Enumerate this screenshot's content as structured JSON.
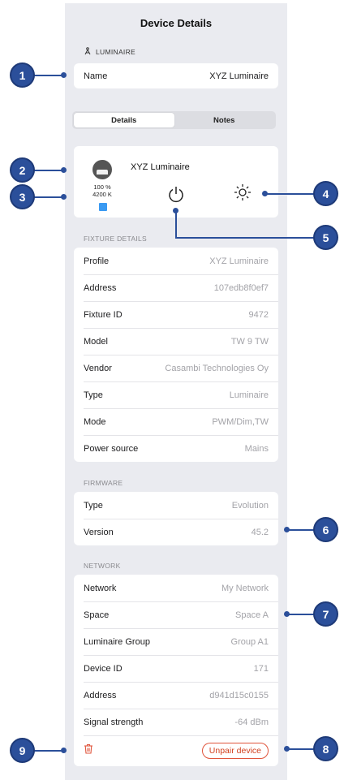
{
  "header": {
    "title": "Device Details"
  },
  "luminaire_section": {
    "label": "LUMINAIRE",
    "name_key": "Name",
    "name_value": "XYZ Luminaire"
  },
  "tabs": [
    {
      "label": "Details",
      "active": true
    },
    {
      "label": "Notes",
      "active": false
    }
  ],
  "device": {
    "name": "XYZ Luminaire",
    "dim_level": "100 %",
    "color_temp": "4200 K",
    "swatch_color": "#3a9af2"
  },
  "fixture": {
    "label": "FIXTURE DETAILS",
    "rows": [
      {
        "key": "Profile",
        "value": "XYZ Luminaire"
      },
      {
        "key": "Address",
        "value": "107edb8f0ef7"
      },
      {
        "key": "Fixture ID",
        "value": "9472"
      },
      {
        "key": "Model",
        "value": "TW 9 TW"
      },
      {
        "key": "Vendor",
        "value": "Casambi Technologies Oy"
      },
      {
        "key": "Type",
        "value": "Luminaire"
      },
      {
        "key": "Mode",
        "value": "PWM/Dim,TW"
      },
      {
        "key": "Power source",
        "value": "Mains"
      }
    ]
  },
  "firmware": {
    "label": "FIRMWARE",
    "rows": [
      {
        "key": "Type",
        "value": "Evolution"
      },
      {
        "key": "Version",
        "value": "45.2"
      }
    ]
  },
  "network": {
    "label": "NETWORK",
    "rows": [
      {
        "key": "Network",
        "value": "My Network"
      },
      {
        "key": "Space",
        "value": "Space A"
      },
      {
        "key": "Luminaire Group",
        "value": "Group A1"
      },
      {
        "key": "Device ID",
        "value": "171"
      },
      {
        "key": "Address",
        "value": "d941d15c0155"
      },
      {
        "key": "Signal strength",
        "value": "-64 dBm"
      }
    ]
  },
  "actions": {
    "unpair_label": "Unpair device",
    "delete_icon": "trash-icon"
  },
  "callouts": [
    "1",
    "2",
    "3",
    "4",
    "5",
    "6",
    "7",
    "8",
    "9"
  ],
  "colors": {
    "callout": "#2b4f9a",
    "danger": "#d2411f",
    "background": "#eaebf0"
  }
}
